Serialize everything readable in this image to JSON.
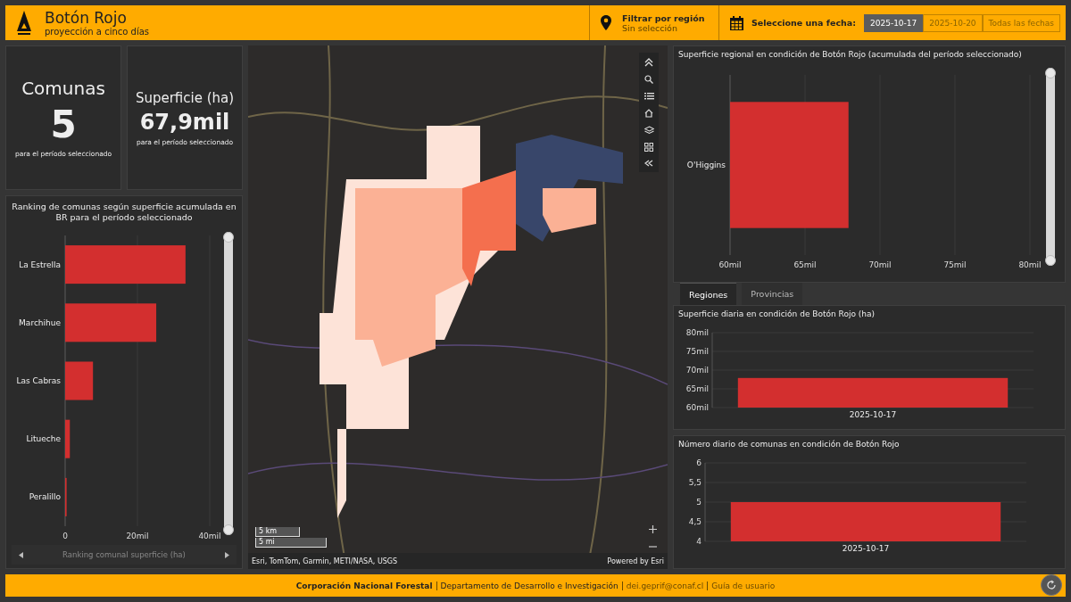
{
  "header": {
    "title": "Botón Rojo",
    "subtitle": "proyección a cinco días",
    "filter": {
      "label": "Filtrar por región",
      "value": "Sin selección"
    },
    "date_label": "Seleccione una fecha:",
    "dates": [
      {
        "label": "2025-10-17",
        "selected": true
      },
      {
        "label": "2025-10-20",
        "selected": false
      },
      {
        "label": "Todas las fechas",
        "selected": false
      }
    ]
  },
  "stats": [
    {
      "title": "Comunas",
      "value": "5",
      "caption": "para el período seleccionado",
      "kind": "big"
    },
    {
      "title": "Superficie (ha)",
      "value": "67,9mil",
      "caption": "para el período seleccionado",
      "kind": "small"
    }
  ],
  "ranking": {
    "title": "Ranking de comunas según superficie acumulada en BR para el período seleccionado",
    "pager": "Ranking comunal superficie (ha)",
    "chart_data": {
      "type": "bar",
      "orientation": "horizontal",
      "grid": true,
      "categories": [
        "La Estrella",
        "Marchihue",
        "Las Cabras",
        "Litueche",
        "Peralillo"
      ],
      "series": [
        {
          "color": "#d32f2f",
          "values": [
            33.3,
            25.2,
            7.7,
            1.3,
            0.4
          ]
        }
      ],
      "xlim": [
        0,
        40
      ],
      "xticks": [
        {
          "value": 0,
          "label": "0"
        },
        {
          "value": 20,
          "label": "20mil"
        },
        {
          "value": 40,
          "label": "40mil"
        }
      ]
    },
    "slider": {
      "level": 1
    }
  },
  "map": {
    "attribution": "Esri, TomTom, Garmin, METI/NASA, USGS",
    "powered_by": "Powered by Esri",
    "scale": [
      "5 km",
      "5 mi"
    ]
  },
  "regional": {
    "title": "Superficie regional en condición de Botón Rojo (acumulada del período seleccionado)",
    "chart_data": {
      "type": "bar",
      "orientation": "horizontal",
      "grid": true,
      "categories": [
        "O'Higgins"
      ],
      "series": [
        {
          "color": "#d32f2f",
          "values": [
            67.9
          ]
        }
      ],
      "xlim": [
        60,
        80
      ],
      "xticks": [
        {
          "value": 60,
          "label": "60mil"
        },
        {
          "value": 65,
          "label": "65mil"
        },
        {
          "value": 70,
          "label": "70mil"
        },
        {
          "value": 75,
          "label": "75mil"
        },
        {
          "value": 80,
          "label": "80mil"
        }
      ]
    },
    "slider": {
      "level": 1
    }
  },
  "tabs": [
    {
      "label": "Regiones",
      "selected": true
    },
    {
      "label": "Provincias",
      "selected": false
    }
  ],
  "daily": {
    "title": "Superficie diaria en condición de Botón Rojo (ha)",
    "chart_data": {
      "type": "bar",
      "orientation": "vertical",
      "grid": true,
      "categories": [
        "2025-10-17"
      ],
      "series": [
        {
          "color": "#d32f2f",
          "values": [
            67.9
          ]
        }
      ],
      "ylim": [
        60,
        80
      ],
      "yticks": [
        {
          "value": 60,
          "label": "60mil"
        },
        {
          "value": 65,
          "label": "65mil"
        },
        {
          "value": 70,
          "label": "70mil"
        },
        {
          "value": 75,
          "label": "75mil"
        },
        {
          "value": 80,
          "label": "80mil"
        }
      ]
    }
  },
  "count": {
    "title": "Número diario de comunas en condición de Botón Rojo",
    "chart_data": {
      "type": "bar",
      "orientation": "vertical",
      "grid": true,
      "categories": [
        "2025-10-17"
      ],
      "series": [
        {
          "color": "#d32f2f",
          "values": [
            5
          ]
        }
      ],
      "ylim": [
        4,
        6
      ],
      "yticks": [
        {
          "value": 4,
          "label": "4"
        },
        {
          "value": 4.5,
          "label": "4,5"
        },
        {
          "value": 5,
          "label": "5"
        },
        {
          "value": 5.5,
          "label": "5,5"
        },
        {
          "value": 6,
          "label": "6"
        }
      ]
    }
  },
  "footer": [
    {
      "text": "Corporación Nacional Forestal",
      "kind": "org"
    },
    {
      "text": "Departamento de Desarrollo e Investigación",
      "kind": "text"
    },
    {
      "text": "dei.geprif@conaf.cl",
      "kind": "link"
    },
    {
      "text": "Guía de usuario",
      "kind": "link"
    }
  ]
}
